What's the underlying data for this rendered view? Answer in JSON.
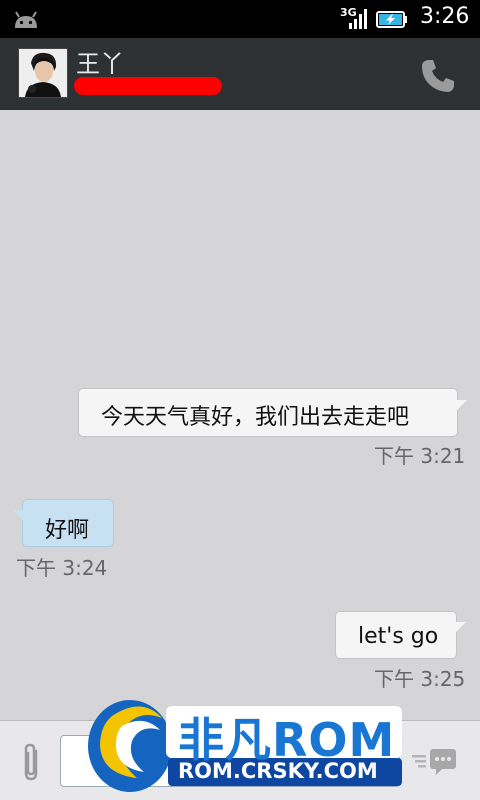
{
  "status_bar": {
    "network": "3G",
    "time": "3:26"
  },
  "conversation": {
    "contact_name": "王丫"
  },
  "messages": [
    {
      "direction": "outgoing",
      "text": "今天天气真好，我们出去走走吧",
      "time": "下午 3:21"
    },
    {
      "direction": "incoming",
      "text": "好啊",
      "time": "下午 3:24"
    },
    {
      "direction": "outgoing",
      "text": "let's go",
      "time": "下午 3:25"
    }
  ],
  "compose": {
    "placeholder": ""
  },
  "watermark": {
    "brand": "非凡ROM",
    "url": "ROM.CRSKY.COM"
  },
  "colors": {
    "chat_bg": "#d5d5d7",
    "action_bar": "#2d3133",
    "incoming_bubble": "#c7e1f2",
    "outgoing_bubble": "#f5f5f5",
    "redaction": "#ff0000"
  }
}
